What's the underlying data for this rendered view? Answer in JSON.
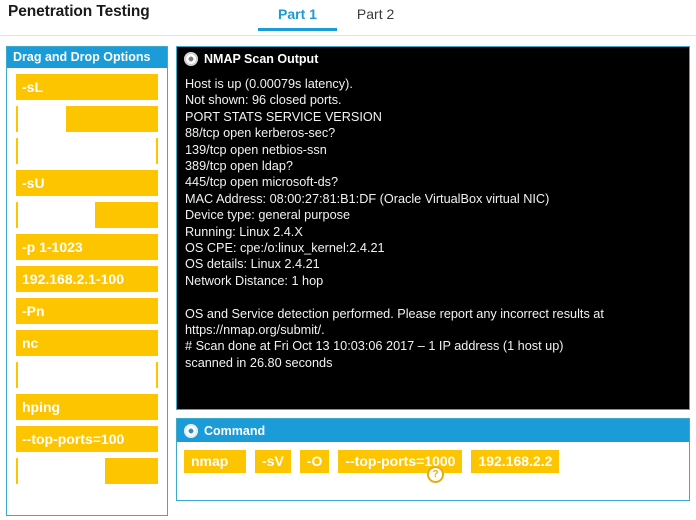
{
  "header": {
    "title": "Penetration Testing",
    "tabs": [
      {
        "label": "Part 1",
        "active": true
      },
      {
        "label": "Part 2",
        "active": false
      }
    ]
  },
  "sidebar": {
    "title": "Drag and Drop Options",
    "items": [
      {
        "label": "-sL",
        "blank": false
      },
      {
        "label": "",
        "blank": true,
        "fill": "fill-right-66"
      },
      {
        "label": "",
        "blank": true,
        "fill": "fill-right-0"
      },
      {
        "label": "-sU",
        "blank": false
      },
      {
        "label": "",
        "blank": true,
        "fill": "fill-right-45"
      },
      {
        "label": "-p 1-1023",
        "blank": false
      },
      {
        "label": "192.168.2.1-100",
        "blank": false
      },
      {
        "label": "-Pn",
        "blank": false
      },
      {
        "label": "nc",
        "blank": false
      },
      {
        "label": "",
        "blank": true,
        "fill": "fill-right-0"
      },
      {
        "label": "hping",
        "blank": false
      },
      {
        "label": "--top-ports=100",
        "blank": false
      },
      {
        "label": "",
        "blank": true,
        "fill": "fill-right-38"
      }
    ]
  },
  "nmap_panel": {
    "title": "NMAP Scan Output",
    "icon": "disc-icon",
    "lines": [
      "Host is up (0.00079s latency).",
      "Not shown: 96 closed ports.",
      "PORT STATS SERVICE VERSION",
      "88/tcp open kerberos-sec?",
      "139/tcp open netbios-ssn",
      "389/tcp open ldap?",
      "445/tcp open microsoft-ds?",
      "MAC Address: 08:00:27:81:B1:DF (Oracle VirtualBox virtual NIC)",
      "Device type: general purpose",
      "Running: Linux 2.4.X",
      "OS CPE: cpe:/o:linux_kernel:2.4.21",
      "OS details: Linux 2.4.21",
      "Network Distance: 1 hop",
      "",
      "OS and Service detection performed. Please report any incorrect results at",
      "https://nmap.org/submit/.",
      "# Scan done at Fri Oct 13 10:03:06 2017 – 1 IP address (1 host up)",
      "scanned in 26.80 seconds"
    ]
  },
  "command_panel": {
    "title": "Command",
    "icon": "disc-icon",
    "chips": [
      "nmap",
      "-sV",
      "-O",
      "--top-ports=1000",
      "192.168.2.2"
    ],
    "drop_badge": "?"
  },
  "colors": {
    "accent_blue": "#1b9bd8",
    "chip_yellow": "#fdc500",
    "terminal_bg": "#000000",
    "terminal_fg": "#f2f2f2",
    "panel_border": "#3fa9c9"
  }
}
